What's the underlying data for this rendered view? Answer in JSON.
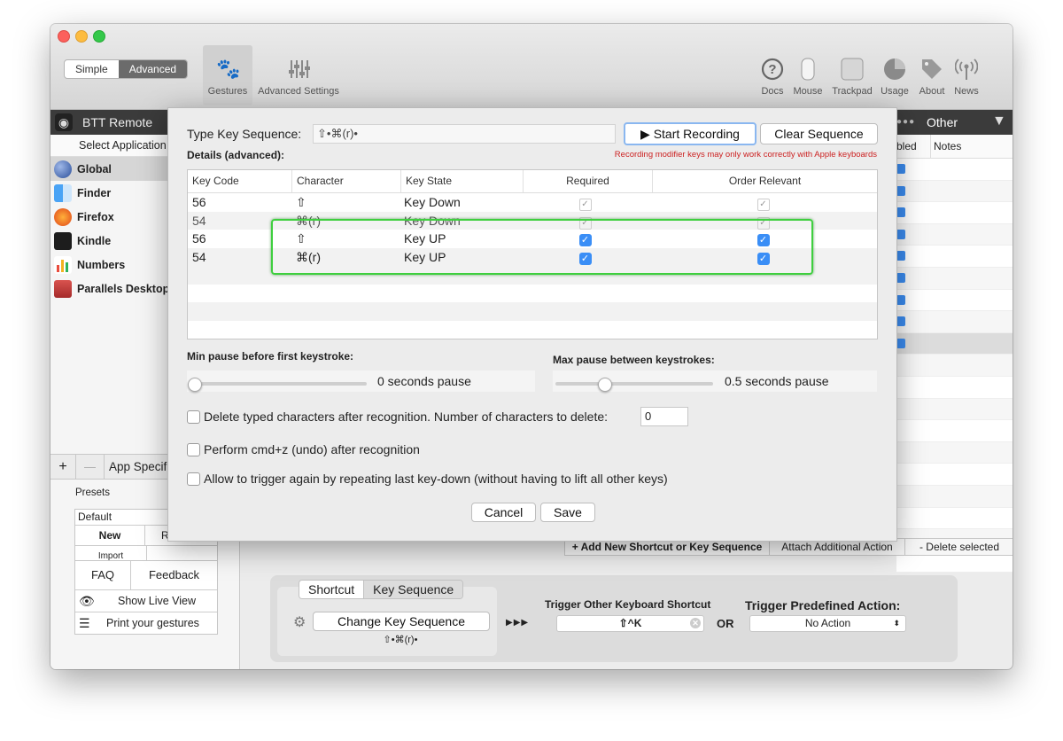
{
  "toolbar": {
    "mode_simple": "Simple",
    "mode_advanced": "Advanced",
    "tab_gestures": "Gestures",
    "tab_advanced_settings": "Advanced Settings",
    "right_items": [
      "Docs",
      "Mouse",
      "Trackpad",
      "Usage",
      "About",
      "News"
    ]
  },
  "darkbar": {
    "remote_label": "BTT Remote",
    "other_label": "Other"
  },
  "sidebar": {
    "select_app_label": "Select Application",
    "apps": [
      "Global",
      "Finder",
      "Firefox",
      "Kindle",
      "Numbers",
      "Parallels Desktop"
    ],
    "add_label": "+",
    "remove_label": "—",
    "app_specific_label": "App Specif",
    "presets_label": "Presets",
    "preset_default": "Default",
    "preset_new": "New",
    "preset_r": "R",
    "preset_import": "Import",
    "faq": "FAQ",
    "feedback": "Feedback",
    "show_live_view": "Show Live View",
    "print_gestures": "Print your gestures"
  },
  "right_table": {
    "header_enabled": "bled",
    "header_notes": "Notes"
  },
  "action_bar": {
    "add_new": "+ Add New Shortcut or Key Sequence",
    "attach": "Attach Additional Action",
    "delete": "- Delete selected"
  },
  "bottom": {
    "tab_shortcut": "Shortcut",
    "tab_key_sequence": "Key Sequence",
    "change_key_sequence": "Change Key Sequence",
    "sequence_display": "⇧•⌘(r)•",
    "arrows": "▶▶▶",
    "trigger_other_label": "Trigger Other Keyboard Shortcut",
    "trigger_other_value": "⇧^K",
    "or": "OR",
    "trigger_predefined_label": "Trigger Predefined Action:",
    "predefined_value": "No Action"
  },
  "modal": {
    "type_label": "Type Key Sequence:",
    "sequence_field": "⇧•⌘(r)•",
    "start_recording": "▶ Start Recording",
    "clear_sequence": "Clear Sequence",
    "details_label": "Details (advanced):",
    "warning": "Recording modifier keys may only work correctly with Apple keyboards",
    "columns": [
      "Key Code",
      "Character",
      "Key State",
      "Required",
      "Order Relevant"
    ],
    "rows": [
      {
        "code": "56",
        "char": "⇧",
        "state": "Key Down",
        "required": true,
        "order": true,
        "dim": true
      },
      {
        "code": "54",
        "char": "⌘(r)",
        "state": "Key Down",
        "required": true,
        "order": true,
        "dim": true
      },
      {
        "code": "56",
        "char": "⇧",
        "state": "Key UP",
        "required": true,
        "order": true,
        "dim": false
      },
      {
        "code": "54",
        "char": "⌘(r)",
        "state": "Key UP",
        "required": true,
        "order": true,
        "dim": false
      }
    ],
    "min_pause_label": "Min pause before first keystroke:",
    "min_pause_value": "0 seconds pause",
    "min_pause_fraction": 0.0,
    "max_pause_label": "Max pause between keystrokes:",
    "max_pause_value": "0.5 seconds pause",
    "max_pause_fraction": 0.27,
    "delete_typed_label": "Delete typed characters after recognition. Number of characters to delete:",
    "delete_count": "0",
    "cmdz_label": "Perform cmd+z (undo) after recognition",
    "allow_trigger_label": "Allow to trigger again by repeating last key-down (without having to lift all other keys)",
    "cancel": "Cancel",
    "save": "Save"
  },
  "colors": {
    "accent": "#3a8ef6",
    "highlight_border": "#3fcf3f",
    "warning": "#cc2222"
  }
}
